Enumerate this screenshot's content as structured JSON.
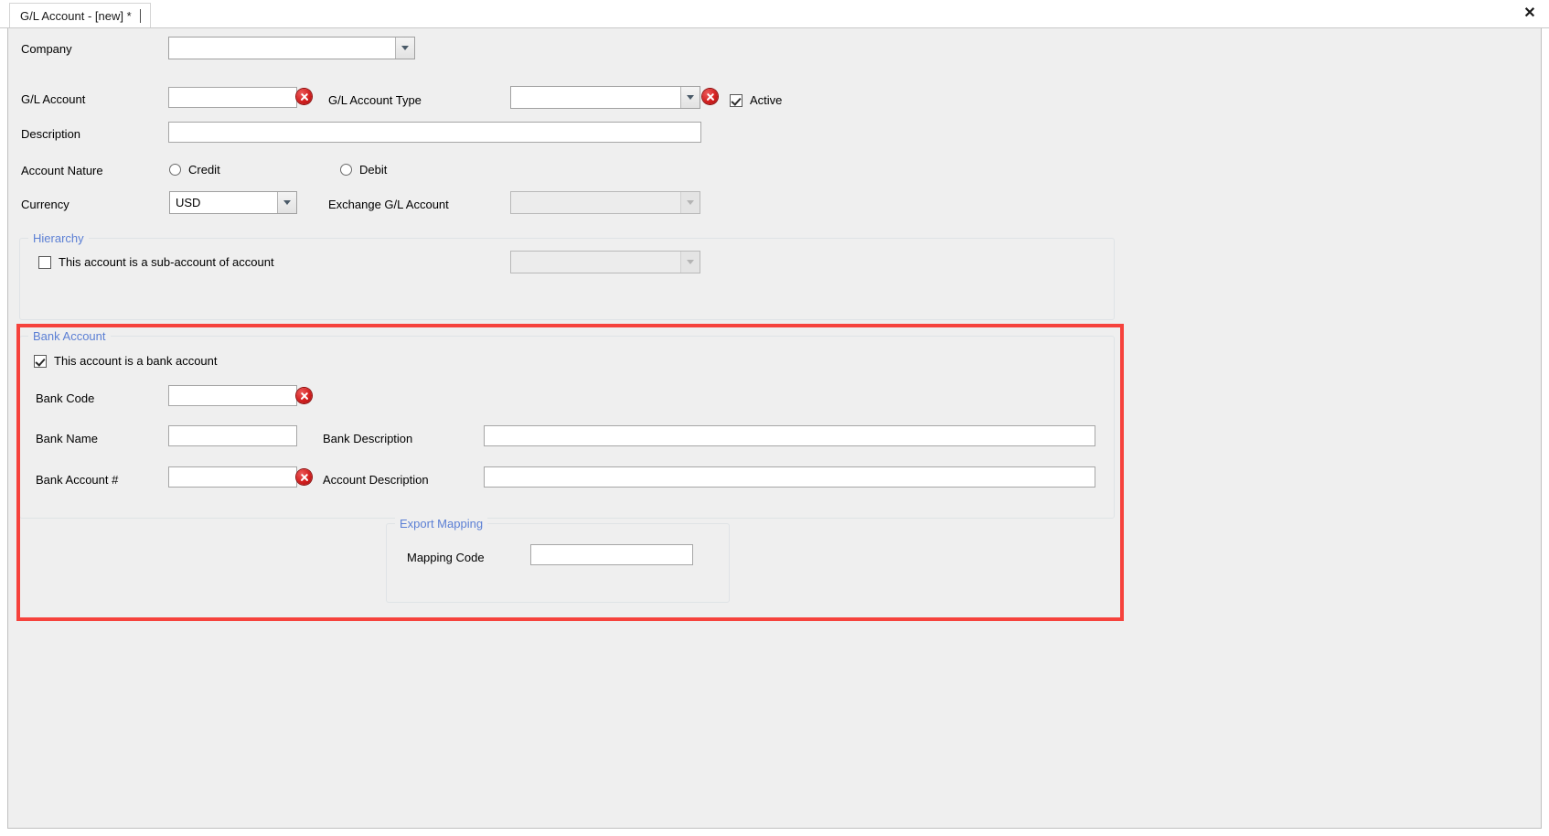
{
  "window": {
    "tab_label": "G/L Account - [new] *",
    "close_label": "✕"
  },
  "form": {
    "company": {
      "label": "Company",
      "value": ""
    },
    "gl_account": {
      "label": "G/L Account",
      "value": "",
      "error": true
    },
    "gl_account_type": {
      "label": "G/L Account Type",
      "value": "",
      "error": true
    },
    "active": {
      "label": "Active",
      "checked": true
    },
    "description": {
      "label": "Description",
      "value": ""
    },
    "account_nature": {
      "label": "Account Nature",
      "options": [
        {
          "label": "Credit",
          "selected": false
        },
        {
          "label": "Debit",
          "selected": false
        }
      ]
    },
    "currency": {
      "label": "Currency",
      "value": "USD"
    },
    "exchange_gl_account": {
      "label": "Exchange G/L Account",
      "value": "",
      "disabled": true
    }
  },
  "hierarchy": {
    "title": "Hierarchy",
    "sub_account_checkbox": {
      "label": "This account is a sub-account of account",
      "checked": false
    },
    "parent_account": {
      "value": "",
      "disabled": true
    }
  },
  "bank_account": {
    "title": "Bank Account",
    "is_bank_account": {
      "label": "This account is a bank account",
      "checked": true
    },
    "bank_code": {
      "label": "Bank Code",
      "value": "",
      "error": true
    },
    "bank_name": {
      "label": "Bank Name",
      "value": ""
    },
    "bank_description": {
      "label": "Bank Description",
      "value": ""
    },
    "bank_account_number": {
      "label": "Bank Account #",
      "value": "",
      "error": true
    },
    "account_description": {
      "label": "Account Description",
      "value": ""
    },
    "export_mapping": {
      "title": "Export Mapping",
      "mapping_code": {
        "label": "Mapping Code",
        "value": ""
      }
    }
  },
  "colors": {
    "highlight": "#f6423c",
    "group_title": "#5b7fd4",
    "error": "#d32020",
    "background": "#efefef"
  }
}
